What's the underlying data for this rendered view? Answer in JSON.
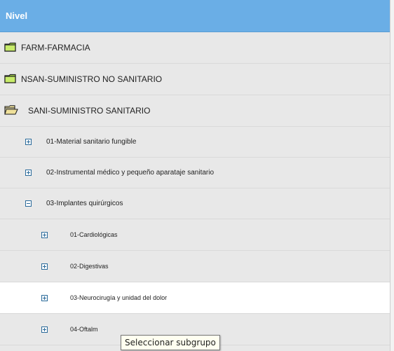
{
  "header": {
    "title": "Nivel"
  },
  "tree": {
    "farm": {
      "label": "FARM-FARMACIA",
      "icon": "folder-closed-icon"
    },
    "nsan": {
      "label": "NSAN-SUMINISTRO NO SANITARIO",
      "icon": "folder-closed-icon"
    },
    "sani": {
      "label": "SANI-SUMINISTRO SANITARIO",
      "icon": "folder-open-icon",
      "expanded": true
    },
    "sani_children": [
      {
        "label": "01-Material sanitario fungible",
        "state": "collapsed"
      },
      {
        "label": "02-Instrumental médico y pequeño aparataje sanitario",
        "state": "collapsed"
      },
      {
        "label": "03-Implantes quirúrgicos",
        "state": "expanded"
      }
    ],
    "implantes_children": [
      {
        "label": "01-Cardiológicas",
        "state": "collapsed"
      },
      {
        "label": "02-Digestivas",
        "state": "collapsed"
      },
      {
        "label": "03-Neurocirugía y unidad del dolor",
        "state": "collapsed",
        "selected": true
      },
      {
        "label": "04-Oftalm",
        "state": "collapsed"
      }
    ]
  },
  "tooltip": {
    "text": "Seleccionar subgrupo"
  },
  "colors": {
    "header_bg": "#6aaee6",
    "row_bg": "#e8e8e8",
    "selected_bg": "#ffffff",
    "folder": "#9acd32"
  }
}
